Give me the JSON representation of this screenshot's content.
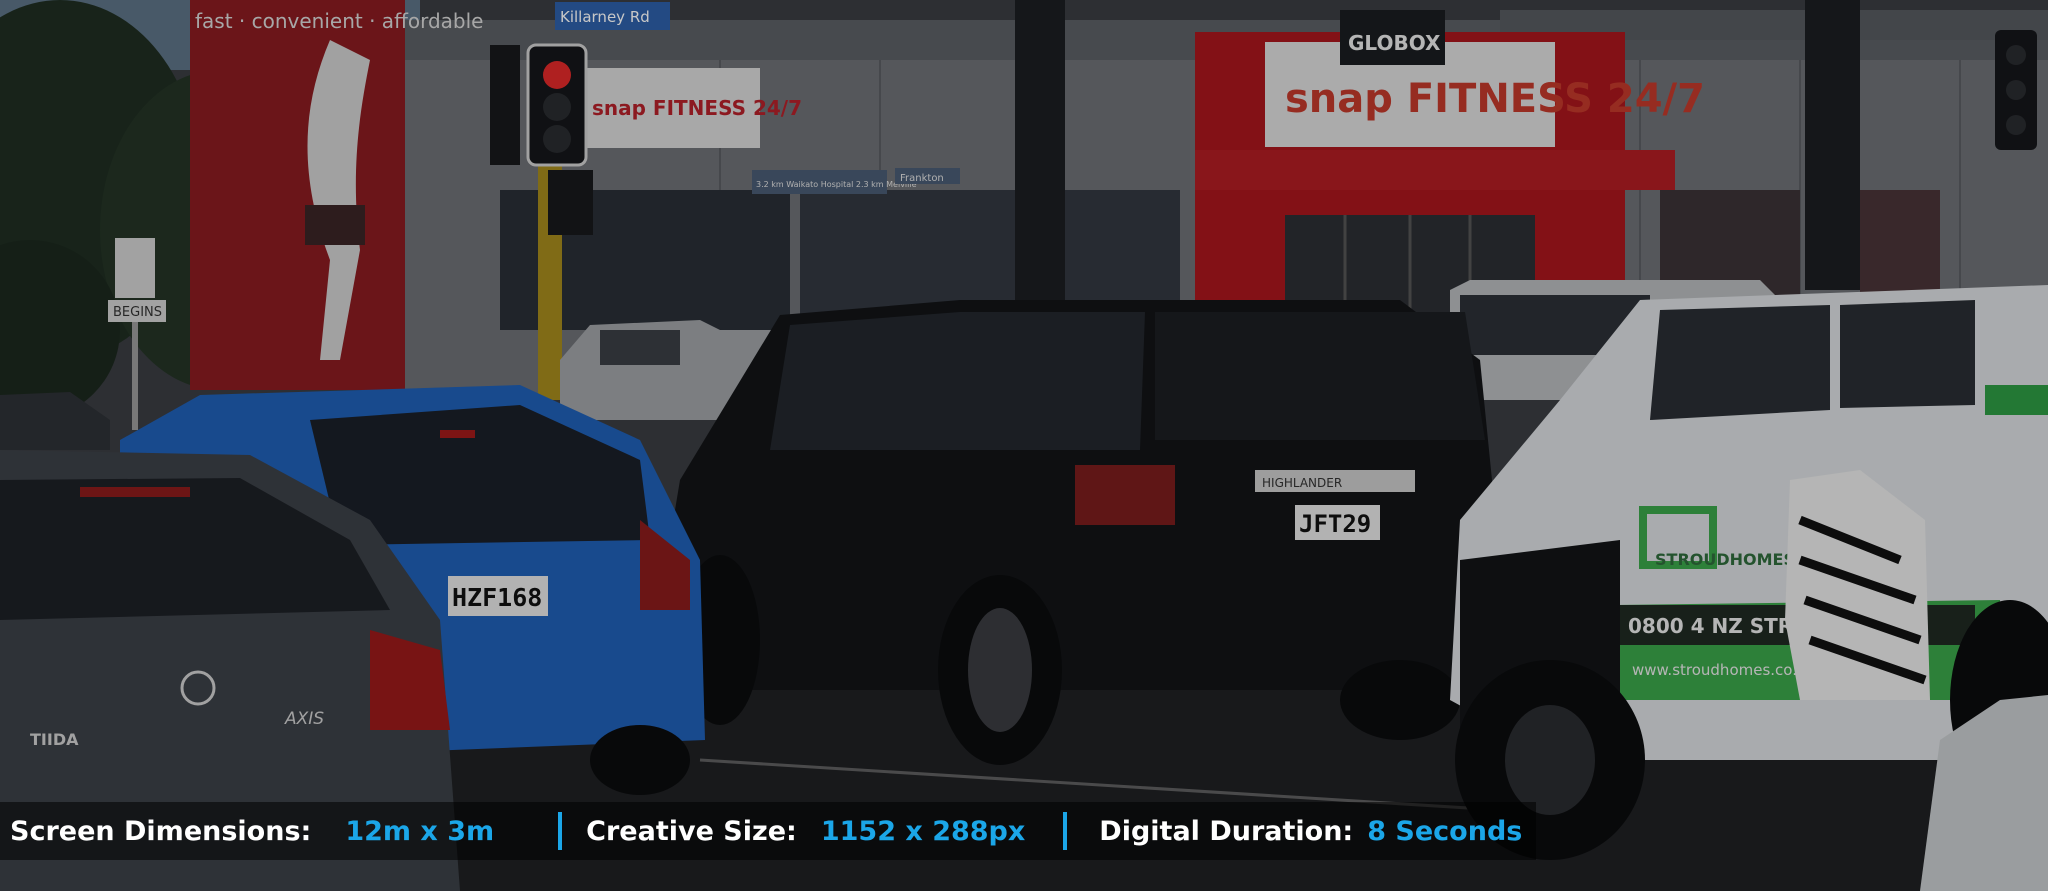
{
  "scene": {
    "signs": {
      "street_sign": "Killarney Rd",
      "gym_banner": "fast · convenient · affordable",
      "gym_name": "snap FITNESS 24/7",
      "globox": "GLOBOX",
      "walk_sign_caption": "BEGINS",
      "direction_sign_left": "3.2 km Waikato Hospital 2.3 km Melville",
      "direction_sign_right": "Frankton"
    },
    "vehicles": {
      "nissan_badge": "TIIDA",
      "nissan_model": "AXIS",
      "honda_plate": "HZF168",
      "toyota_plate": "JFT29",
      "toyota_badge": "HIGHLANDER",
      "ute_brand": "STROUDHOMES",
      "ute_phone": "0800 4 NZ STROUD",
      "ute_web": "www.stroudhomes.co.nz"
    }
  },
  "spec_bar": {
    "screen_label": "Screen Dimensions:",
    "screen_value": "12m x 3m",
    "creative_label": "Creative Size:",
    "creative_value": "1152 x 288px",
    "duration_label": "Digital Duration:",
    "duration_value": "8 Seconds"
  },
  "colors": {
    "accent_blue": "#1ba6e8",
    "gym_red": "#c8232a",
    "honda_blue": "#1f5fb5",
    "toyota_black": "#121417",
    "ute_white": "#d9dcdf",
    "stroud_green": "#3aa54a"
  }
}
